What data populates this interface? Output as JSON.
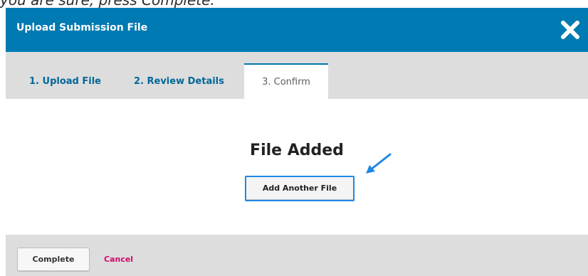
{
  "caption": {
    "prefix": "you are sure, press ",
    "emphasis": "Complete",
    "suffix": "."
  },
  "modal": {
    "title": "Upload Submission File",
    "close_icon": "close-icon"
  },
  "tabs": [
    {
      "label": "1. Upload File",
      "active": false
    },
    {
      "label": "2. Review Details",
      "active": false
    },
    {
      "label": "3. Confirm",
      "active": true
    }
  ],
  "main": {
    "heading": "File Added",
    "add_another_label": "Add Another File",
    "annotation_icon": "arrow-annotation-icon"
  },
  "footer": {
    "complete_label": "Complete",
    "cancel_label": "Cancel"
  },
  "colors": {
    "header_bg": "#007ab2",
    "tab_link": "#006798",
    "cancel": "#d00a6c",
    "highlight": "#1e88e5"
  }
}
